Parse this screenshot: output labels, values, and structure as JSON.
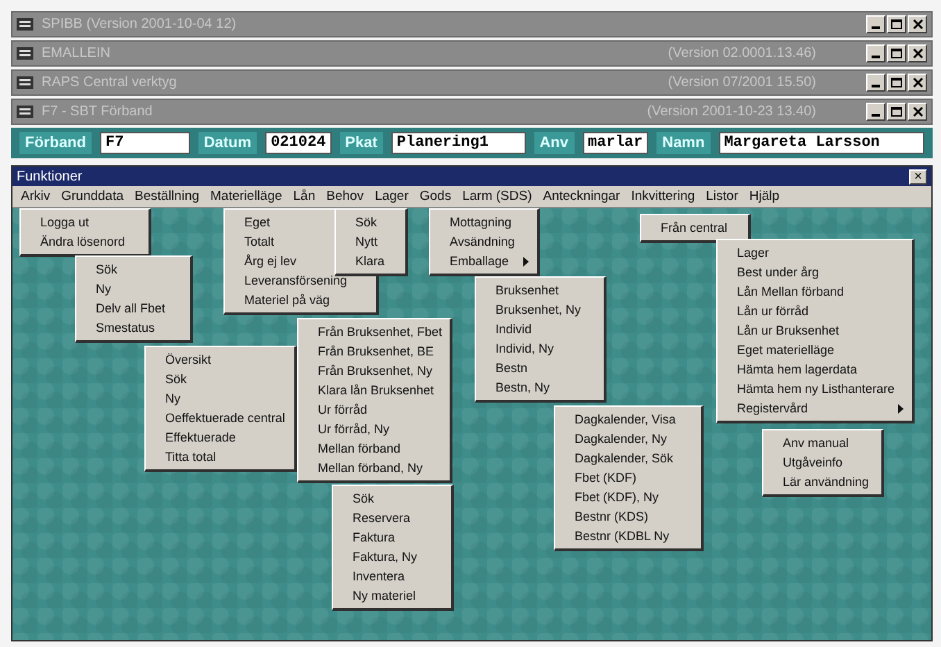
{
  "windows": [
    {
      "title": "SPIBB (Version 2001-10-04 12)"
    },
    {
      "title": "EMALLEIN",
      "version": "(Version 02.0001.13.46)"
    },
    {
      "title": "RAPS Central verktyg",
      "version": "(Version 07/2001 15.50)"
    },
    {
      "title": "F7 - SBT Förband",
      "version": "(Version 2001-10-23 13.40)"
    }
  ],
  "header_fields": [
    {
      "label": "Förband",
      "value": "F7"
    },
    {
      "label": "Datum",
      "value": "021024"
    },
    {
      "label": "Pkat",
      "value": "Planering1"
    },
    {
      "label": "Anv",
      "value": "marlar"
    },
    {
      "label": "Namn",
      "value": "Margareta Larsson"
    }
  ],
  "dialog": {
    "title": "Funktioner",
    "close": "×"
  },
  "menu_bar": [
    "Arkiv",
    "Grunddata",
    "Beställning",
    "Materielläge",
    "Lån",
    "Behov",
    "Lager",
    "Gods",
    "Larm (SDS)",
    "Anteckningar",
    "Inkvittering",
    "Listor",
    "Hjälp"
  ],
  "menus": [
    {
      "items": [
        {
          "label": "Logga ut",
          "submenu": false
        },
        {
          "label": "Ändra lösenord",
          "submenu": false
        }
      ]
    },
    {
      "items": [
        {
          "label": "Sök",
          "submenu": false
        },
        {
          "label": "Ny",
          "submenu": false
        },
        {
          "label": "Delv all Fbet",
          "submenu": false
        },
        {
          "label": "Smestatus",
          "submenu": false
        }
      ]
    },
    {
      "items": [
        {
          "label": "Översikt",
          "submenu": false
        },
        {
          "label": "Sök",
          "submenu": false
        },
        {
          "label": "Ny",
          "submenu": false
        },
        {
          "label": "Oeffektuerade central",
          "submenu": false
        },
        {
          "label": "Effektuerade",
          "submenu": false
        },
        {
          "label": "Titta total",
          "submenu": false
        }
      ]
    },
    {
      "items": [
        {
          "label": "Eget",
          "submenu": false
        },
        {
          "label": "Totalt",
          "submenu": false
        },
        {
          "label": "Årg ej lev",
          "submenu": false
        },
        {
          "label": "Leveransförsening",
          "submenu": false
        },
        {
          "label": "Materiel på väg",
          "submenu": false
        }
      ]
    },
    {
      "items": [
        {
          "label": "Sök",
          "submenu": false
        },
        {
          "label": "Nytt",
          "submenu": false
        },
        {
          "label": "Klara",
          "submenu": false
        }
      ]
    },
    {
      "items": [
        {
          "label": "Från Bruksenhet, Fbet",
          "submenu": false
        },
        {
          "label": "Från Bruksenhet, BE",
          "submenu": false
        },
        {
          "label": "Från Bruksenhet, Ny",
          "submenu": false
        },
        {
          "label": "Klara lån Bruksenhet",
          "submenu": false
        },
        {
          "label": "Ur förråd",
          "submenu": false
        },
        {
          "label": "Ur förråd, Ny",
          "submenu": false
        },
        {
          "label": "Mellan förband",
          "submenu": false
        },
        {
          "label": "Mellan förband, Ny",
          "submenu": false
        }
      ]
    },
    {
      "items": [
        {
          "label": "Mottagning",
          "submenu": false
        },
        {
          "label": "Avsändning",
          "submenu": false
        },
        {
          "label": "Emballage",
          "submenu": true
        }
      ]
    },
    {
      "items": [
        {
          "label": "Bruksenhet",
          "submenu": false
        },
        {
          "label": "Bruksenhet, Ny",
          "submenu": false
        },
        {
          "label": "Individ",
          "submenu": false
        },
        {
          "label": "Individ, Ny",
          "submenu": false
        },
        {
          "label": "Bestn",
          "submenu": false
        },
        {
          "label": "Bestn, Ny",
          "submenu": false
        }
      ]
    },
    {
      "items": [
        {
          "label": "Sök",
          "submenu": false
        },
        {
          "label": "Reservera",
          "submenu": false
        },
        {
          "label": "Faktura",
          "submenu": false
        },
        {
          "label": "Faktura, Ny",
          "submenu": false
        },
        {
          "label": "Inventera",
          "submenu": false
        },
        {
          "label": "Ny materiel",
          "submenu": false
        }
      ]
    },
    {
      "items": [
        {
          "label": "Dagkalender, Visa",
          "submenu": false
        },
        {
          "label": "Dagkalender, Ny",
          "submenu": false
        },
        {
          "label": "Dagkalender, Sök",
          "submenu": false
        },
        {
          "label": "Fbet (KDF)",
          "submenu": false
        },
        {
          "label": "Fbet (KDF), Ny",
          "submenu": false
        },
        {
          "label": "Bestnr (KDS)",
          "submenu": false
        },
        {
          "label": "Bestnr (KDBL Ny",
          "submenu": false
        }
      ]
    },
    {
      "items": [
        {
          "label": "Från central",
          "submenu": false
        }
      ]
    },
    {
      "items": [
        {
          "label": "Lager",
          "submenu": false
        },
        {
          "label": "Best under årg",
          "submenu": false
        },
        {
          "label": "Lån Mellan förband",
          "submenu": false
        },
        {
          "label": "Lån ur förråd",
          "submenu": false
        },
        {
          "label": "Lån ur Bruksenhet",
          "submenu": false
        },
        {
          "label": "Eget materielläge",
          "submenu": false
        },
        {
          "label": "Hämta hem lagerdata",
          "submenu": false
        },
        {
          "label": "Hämta hem ny Listhanterare",
          "submenu": false
        },
        {
          "label": "Registervård",
          "submenu": true
        }
      ]
    },
    {
      "items": [
        {
          "label": "Anv manual",
          "submenu": false
        },
        {
          "label": "Utgåveinfo",
          "submenu": false
        },
        {
          "label": "Lär användning",
          "submenu": false
        }
      ]
    }
  ]
}
